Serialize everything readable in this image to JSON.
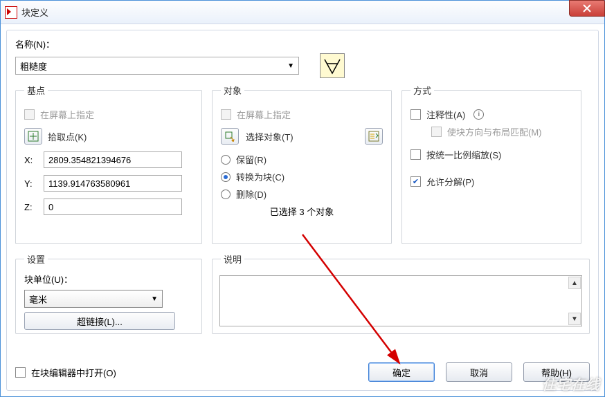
{
  "window": {
    "title": "块定义"
  },
  "name_section": {
    "label": "名称(N)：",
    "value": "粗糙度"
  },
  "basepoint": {
    "legend": "基点",
    "onscreen_label": "在屏幕上指定",
    "pick_label": "拾取点(K)",
    "x_label": "X:",
    "x_value": "2809.354821394676",
    "y_label": "Y:",
    "y_value": "1139.914763580961",
    "z_label": "Z:",
    "z_value": "0"
  },
  "objects": {
    "legend": "对象",
    "onscreen_label": "在屏幕上指定",
    "select_label": "选择对象(T)",
    "retain_label": "保留(R)",
    "convert_label": "转换为块(C)",
    "delete_label": "删除(D)",
    "selected_note": "已选择 3 个对象"
  },
  "mode": {
    "legend": "方式",
    "annotative_label": "注释性(A)",
    "orient_label": "使块方向与布局匹配(M)",
    "uniform_label": "按统一比例缩放(S)",
    "explode_label": "允许分解(P)"
  },
  "settings": {
    "legend": "设置",
    "unit_label": "块单位(U)：",
    "unit_value": "毫米",
    "hyperlink_label": "超链接(L)..."
  },
  "description": {
    "legend": "说明",
    "text": ""
  },
  "footer": {
    "open_editor_label": "在块编辑器中打开(O)",
    "ok": "确定",
    "cancel": "取消",
    "help": "帮助(H)"
  }
}
